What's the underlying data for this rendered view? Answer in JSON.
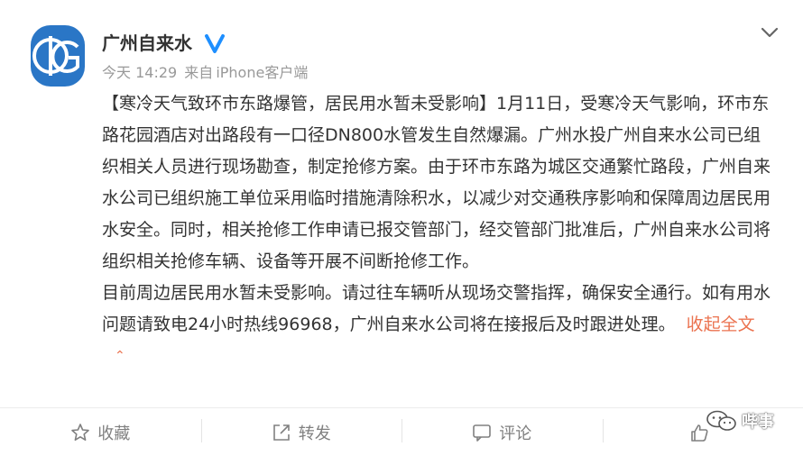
{
  "post": {
    "username": "广州自来水",
    "timestamp": "今天 14:29",
    "source_prefix": "来自",
    "source": "iPhone客户端",
    "body_paragraphs": [
      "【寒冷天气致环市东路爆管，居民用水暂未受影响】1月11日，受寒冷天气影响，环市东路花园酒店对出路段有一口径DN800水管发生自然爆漏。广州水投广州自来水公司已组织相关人员进行现场勘查，制定抢修方案。由于环市东路为城区交通繁忙路段，广州自来水公司已组织施工单位采用临时措施清除积水，以减少对交通秩序影响和保障周边居民用水安全。同时，相关抢修工作申请已报交管部门，经交管部门批准后，广州自来水公司将组织相关抢修车辆、设备等开展不间断抢修工作。",
      "目前周边居民用水暂未受影响。请过往车辆听从现场交警指挥，确保安全通行。如有用水问题请致电24小时热线96968，广州自来水公司将在接报后及时跟进处理。"
    ],
    "collapse_label": "收起全文"
  },
  "actions": {
    "favorite_label": "收藏",
    "repost_label": "转发",
    "comment_label": "评论",
    "like_label": ""
  },
  "watermark": {
    "text": "哔事"
  },
  "colors": {
    "link": "#eb7350",
    "text": "#333333",
    "meta": "#999999",
    "verified": "#1e8fff",
    "avatar": "#2a76c6"
  },
  "icons": {
    "avatar": "logo-avatar",
    "verified": "verified-badge-icon",
    "more": "chevron-down-icon",
    "favorite": "star-icon",
    "repost": "repost-icon",
    "comment": "comment-icon",
    "like": "thumbs-up-icon",
    "watermark": "wechat-icon"
  }
}
